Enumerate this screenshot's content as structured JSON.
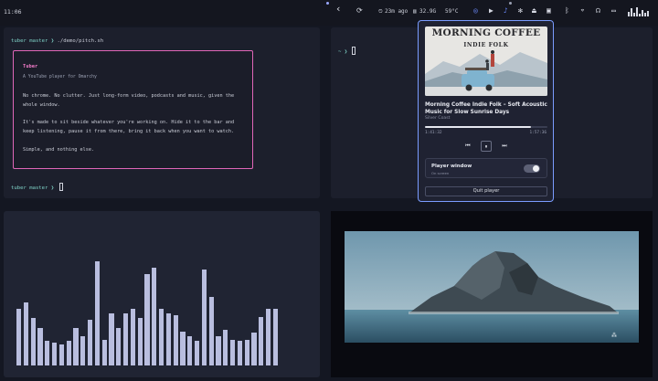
{
  "topbar": {
    "clock": "11:06",
    "back_glyph": "‹",
    "uptime": "23m ago",
    "memory": "32.9G",
    "temperature": "59°C",
    "icons": [
      "whatsapp-icon",
      "youtube-icon",
      "bell-icon",
      "settings-icon",
      "eject-icon",
      "bluetooth-icon",
      "wifi-icon",
      "headphones-icon",
      "monitor-icon",
      "equalizer-icon"
    ],
    "accent": "#6d8cff"
  },
  "terminal_top": {
    "prompt1_dir": "tuber master",
    "prompt1_symbol": "❯",
    "prompt1_cmd": "./demo/pitch.sh",
    "prompt2_dir": "tuber master",
    "prompt2_symbol": "❯"
  },
  "readme": {
    "title": "Tuber",
    "subtitle": "A YouTube player for Omarchy",
    "p1": "No chrome. No clutter. Just long-form video, podcasts and music, given the whole window.",
    "p2": "It's made to sit beside whatever you're working on. Hide it to the bar and keep listening, pause it from there, bring it back when you want to watch.",
    "p3": "Simple, and nothing else.",
    "border_color": "#e066b8"
  },
  "terminal_right": {
    "prompt_symbol": "~ ❯"
  },
  "player": {
    "cover_line1": "MORNING COFFEE",
    "cover_line2": "INDIE FOLK",
    "track_title": "Morning Coffee Indie Folk – Soft Acoustic Music for Slow Sunrise Days",
    "artist": "Silver Coast",
    "elapsed": "1:41:32",
    "duration": "1:57:36",
    "progress": 0.863,
    "prev_glyph": "⏮",
    "pause_glyph": "⏸",
    "next_glyph": "⏭",
    "player_window_label": "Player window",
    "player_window_sub": "On screen",
    "player_window_on": true,
    "quit_label": "Quit player"
  },
  "visualizer": {
    "levels": [
      0.35,
      0.39,
      0.29,
      0.23,
      0.15,
      0.14,
      0.13,
      0.15,
      0.23,
      0.18,
      0.28,
      0.64,
      0.16,
      0.32,
      0.23,
      0.32,
      0.35,
      0.29,
      0.56,
      0.6,
      0.35,
      0.32,
      0.31,
      0.21,
      0.18,
      0.15,
      0.59,
      0.42,
      0.18,
      0.22,
      0.16,
      0.15,
      0.16,
      0.2,
      0.3,
      0.35,
      0.35
    ],
    "color": "#b9bedf"
  }
}
